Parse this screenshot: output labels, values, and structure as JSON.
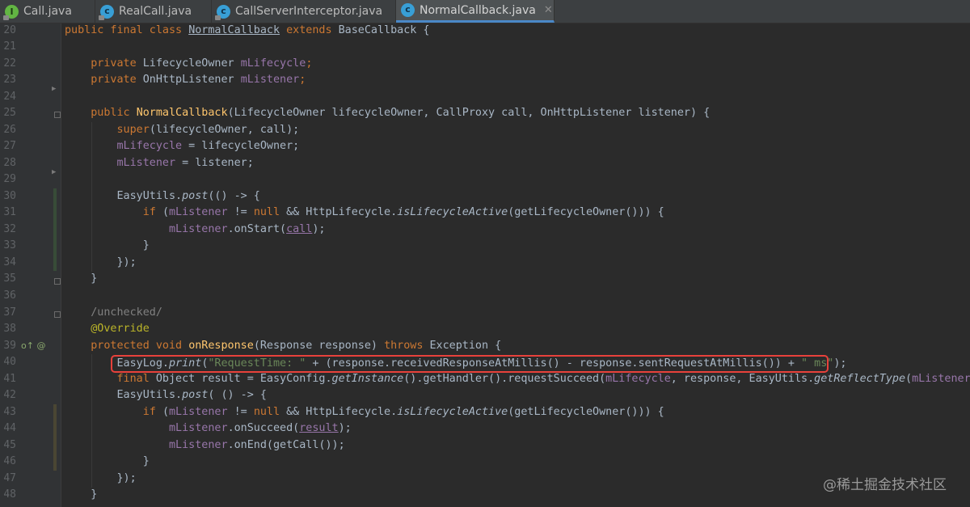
{
  "tabs": [
    {
      "label": "Call.java",
      "icon": "interface-icon",
      "active": false
    },
    {
      "label": "RealCall.java",
      "icon": "class-icon",
      "active": false
    },
    {
      "label": "CallServerInterceptor.java",
      "icon": "class-icon",
      "active": false
    },
    {
      "label": "NormalCallback.java",
      "icon": "class-icon",
      "active": true
    }
  ],
  "line_numbers": [
    "20",
    "21",
    "22",
    "23",
    "24",
    "25",
    "26",
    "27",
    "28",
    "29",
    "30",
    "31",
    "32",
    "33",
    "34",
    "35",
    "36",
    "37",
    "38",
    "39",
    "40",
    "41",
    "42",
    "43",
    "44",
    "45",
    "46",
    "47",
    "48"
  ],
  "code": {
    "l20": {
      "a": "public final class ",
      "b": "NormalCallback",
      "c": " extends ",
      "d": "BaseCallback {"
    },
    "l22": {
      "a": "    private ",
      "b": "LifecycleOwner ",
      "c": "mLifecycle",
      "d": ";"
    },
    "l23": {
      "a": "    private ",
      "b": "OnHttpListener ",
      "c": "mListener",
      "d": ";"
    },
    "l25": {
      "a": "    public ",
      "b": "NormalCallback",
      "c": "(LifecycleOwner lifecycleOwner, CallProxy call, OnHttpListener listener) {"
    },
    "l26": {
      "a": "        super",
      "b": "(lifecycleOwner, call);"
    },
    "l27": {
      "a": "        ",
      "b": "mLifecycle",
      "c": " = lifecycleOwner;"
    },
    "l28": {
      "a": "        ",
      "b": "mListener",
      "c": " = listener;"
    },
    "l30": {
      "a": "        EasyUtils.",
      "b": "post",
      "c": "(() -> {"
    },
    "l31": {
      "a": "            if ",
      "b": "(",
      "c": "mListener",
      "d": " != ",
      "e": "null",
      "f": " && HttpLifecycle.",
      "g": "isLifecycleActive",
      "h": "(getLifecycleOwner())) {"
    },
    "l32": {
      "a": "                ",
      "b": "mListener",
      "c": ".onStart(",
      "d": "call",
      "e": ");"
    },
    "l33": {
      "a": "            }"
    },
    "l34": {
      "a": "        });"
    },
    "l35": {
      "a": "    }"
    },
    "l37": {
      "a": "    /unchecked/"
    },
    "l38": {
      "a": "    @Override"
    },
    "l39": {
      "a": "    protected void ",
      "b": "onResponse",
      "c": "(Response response) ",
      "d": "throws ",
      "e": "Exception {"
    },
    "l40": {
      "a": "        EasyLog.",
      "b": "print",
      "c": "(",
      "d": "\"RequestTime: \"",
      "e": " + (response.receivedResponseAtMillis() - response.sentRequestAtMillis()) + ",
      "f": "\" ms\"",
      "g": ");"
    },
    "l41": {
      "a": "        final ",
      "b": "Object result = EasyConfig.",
      "c": "getInstance",
      "d": "().getHandler().requestSucceed(",
      "e": "mLifecycle",
      "f": ", response, EasyUtils.",
      "g": "getReflectType",
      "h": "(",
      "i": "mListener",
      "j": "));"
    },
    "l42": {
      "a": "        EasyUtils.",
      "b": "post",
      "c": "( () -> {"
    },
    "l43": {
      "a": "            if ",
      "b": "(",
      "c": "mListener",
      "d": " != ",
      "e": "null",
      "f": " && HttpLifecycle.",
      "g": "isLifecycleActive",
      "h": "(getLifecycleOwner())) {"
    },
    "l44": {
      "a": "                ",
      "b": "mListener",
      "c": ".onSucceed(",
      "d": "result",
      "e": ");"
    },
    "l45": {
      "a": "                ",
      "b": "mListener",
      "c": ".onEnd(getCall());"
    },
    "l46": {
      "a": "            }"
    },
    "l47": {
      "a": "        });"
    },
    "l48": {
      "a": "    }"
    }
  },
  "gutter_marker": "o↑ @",
  "watermark": "@稀土掘金技术社区",
  "colors": {
    "keyword": "#cc7832",
    "field": "#9876aa",
    "method": "#ffc66d",
    "string": "#6a8759",
    "annotation": "#bbb529",
    "highlight": "#e8413b"
  }
}
